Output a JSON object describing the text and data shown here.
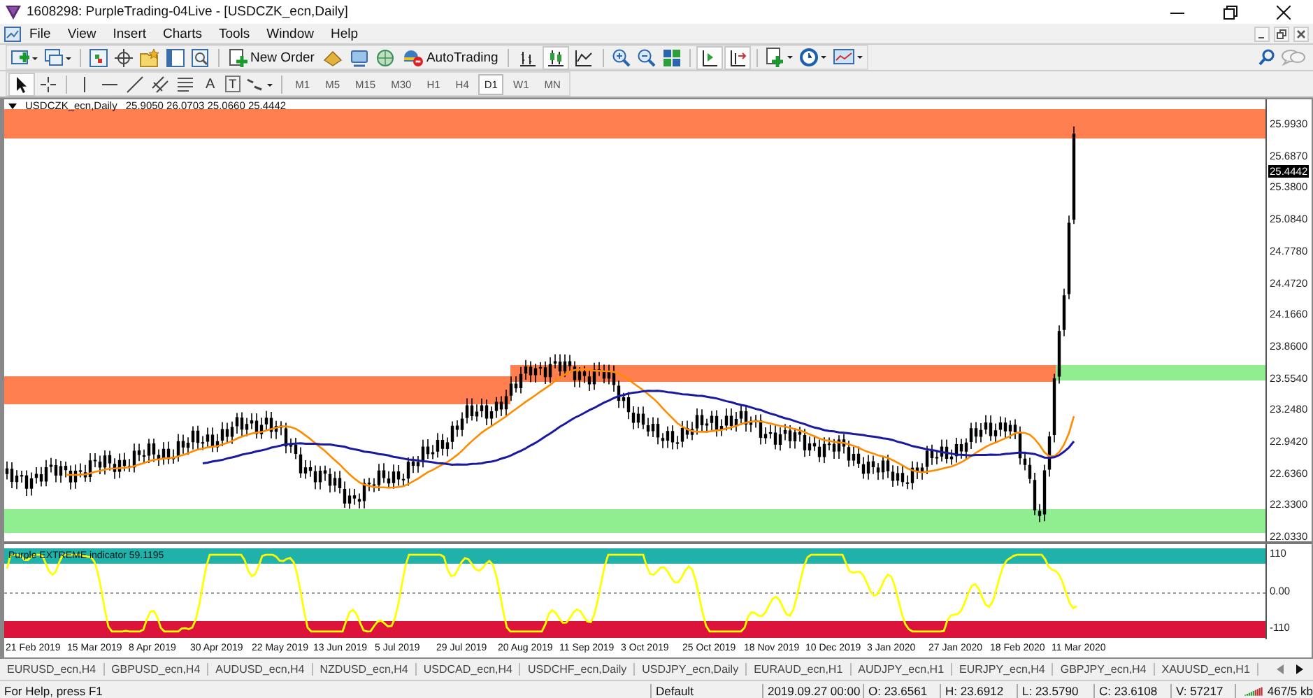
{
  "window": {
    "title": "1608298: PurpleTrading-04Live - [USDCZK_ecn,Daily]"
  },
  "menu": [
    "File",
    "View",
    "Insert",
    "Charts",
    "Tools",
    "Window",
    "Help"
  ],
  "toolbar": {
    "new_order": "New Order",
    "auto_trading": "AutoTrading",
    "auto_trading_enabled": false,
    "auto_scroll": true,
    "chart_shift": true
  },
  "chart_types": [
    {
      "kind": "bars",
      "selected": false
    },
    {
      "kind": "candles",
      "selected": true
    },
    {
      "kind": "line",
      "selected": false
    }
  ],
  "drawing_tools": {
    "text_tool": "A",
    "label_tool": "T"
  },
  "timeframes": [
    {
      "label": "M1",
      "selected": false
    },
    {
      "label": "M5",
      "selected": false
    },
    {
      "label": "M15",
      "selected": false
    },
    {
      "label": "M30",
      "selected": false
    },
    {
      "label": "H1",
      "selected": false
    },
    {
      "label": "H4",
      "selected": false
    },
    {
      "label": "D1",
      "selected": true
    },
    {
      "label": "W1",
      "selected": false
    },
    {
      "label": "MN",
      "selected": false
    }
  ],
  "chart": {
    "symbol": "USDCZK_ecn,Daily",
    "quotes": "25.9050 26.0703 25.0660 25.4442",
    "price_ticks": [
      "25.9930",
      "25.6870",
      "25.3800",
      "25.0840",
      "24.7780",
      "24.4720",
      "24.1660",
      "23.8600",
      "23.5540",
      "23.2480",
      "22.9420",
      "22.6360",
      "22.3300",
      "22.0330"
    ],
    "current_price": "25.4442",
    "indicator": {
      "label": "Purple EXTREME indicator 59.1195",
      "ticks": [
        "110",
        "0.00",
        "-110"
      ]
    },
    "dates": [
      "21 Feb 2019",
      "15 Mar 2019",
      "8 Apr 2019",
      "30 Apr 2019",
      "22 May 2019",
      "13 Jun 2019",
      "5 Jul 2019",
      "29 Jul 2019",
      "20 Aug 2019",
      "11 Sep 2019",
      "3 Oct 2019",
      "25 Oct 2019",
      "18 Nov 2019",
      "10 Dec 2019",
      "3 Jan 2020",
      "27 Jan 2020",
      "18 Feb 2020",
      "11 Mar 2020"
    ]
  },
  "tabs": [
    "EURUSD_ecn,H4",
    "GBPUSD_ecn,H4",
    "AUDUSD_ecn,H4",
    "NZDUSD_ecn,H4",
    "USDCAD_ecn,H4",
    "USDCHF_ecn,Daily",
    "USDJPY_ecn,Daily",
    "EURAUD_ecn,H1",
    "AUDJPY_ecn,H1",
    "EURJPY_ecn,H4",
    "GBPJPY_ecn,H4",
    "XAUUSD_ecn,H1"
  ],
  "status_bar": {
    "help": "For Help, press F1",
    "profile": "Default",
    "time": "2019.09.27 00:00",
    "open": "O: 23.6561",
    "high": "H: 23.6912",
    "low": "L: 23.5790",
    "close": "C: 23.6108",
    "volume": "V: 57217",
    "traffic": "467/5 kb"
  }
}
